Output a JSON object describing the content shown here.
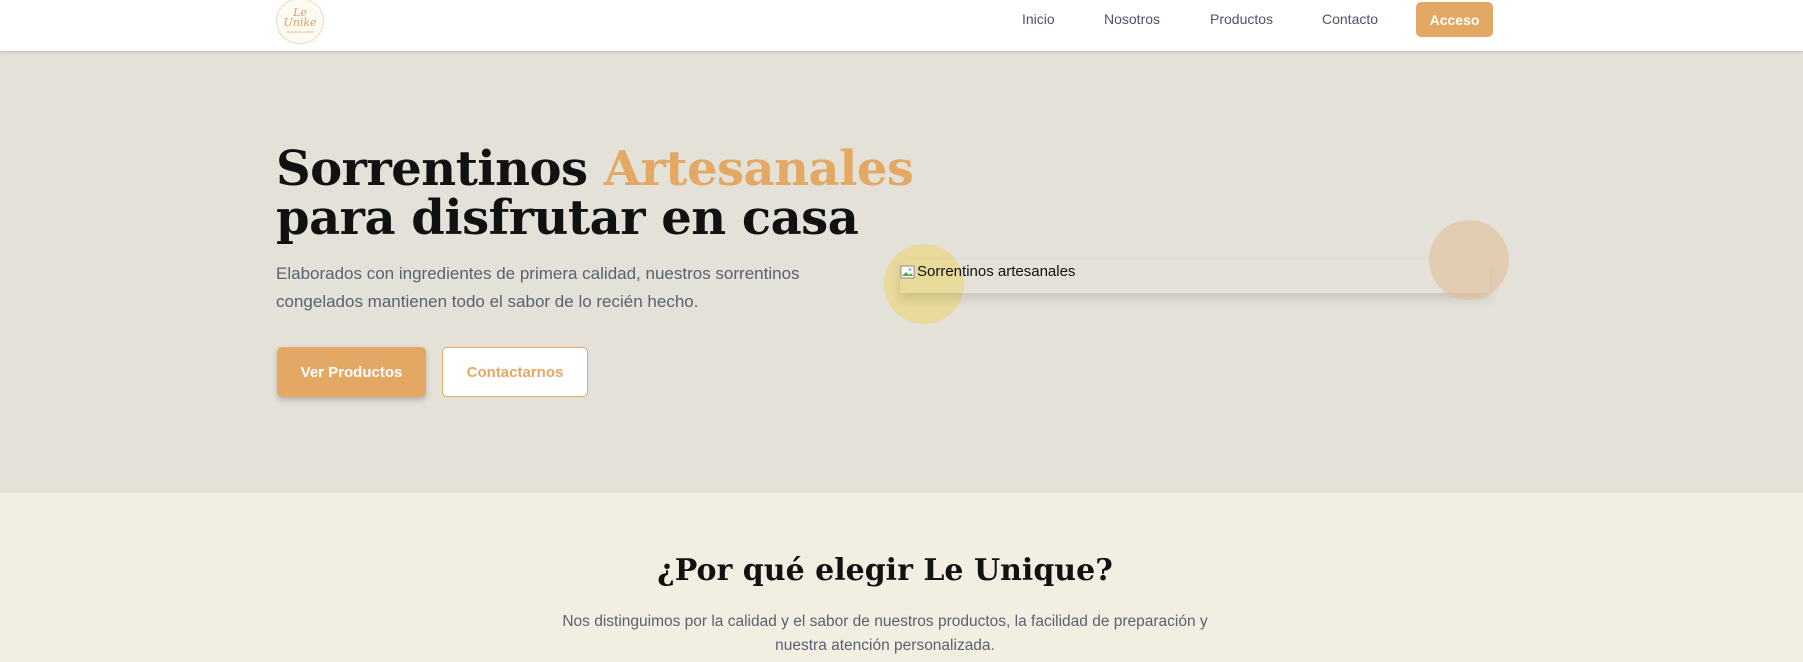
{
  "header": {
    "logo_text": "Le\nUnike",
    "logo_subtext": "MASAS DE AUTOR",
    "nav": [
      "Inicio",
      "Nosotros",
      "Productos",
      "Contacto"
    ],
    "access_label": "Acceso"
  },
  "hero": {
    "title_part1": "Sorrentinos ",
    "title_accent": "Artesanales",
    "title_line2": "para disfrutar en casa",
    "description": "Elaborados con ingredientes de primera calidad, nuestros sorrentinos congelados mantienen todo el sabor de lo recién hecho.",
    "primary_button": "Ver Productos",
    "secondary_button": "Contactarnos",
    "image_alt": "Sorrentinos artesanales"
  },
  "why": {
    "title": "¿Por qué elegir Le Unique?",
    "description": "Nos distinguimos por la calidad y el sabor de nuestros productos, la facilidad de preparación y nuestra atención personalizada."
  },
  "colors": {
    "accent": "#e3a864",
    "hero_bg": "#e3e1d8",
    "section_bg": "#f2eee2"
  }
}
